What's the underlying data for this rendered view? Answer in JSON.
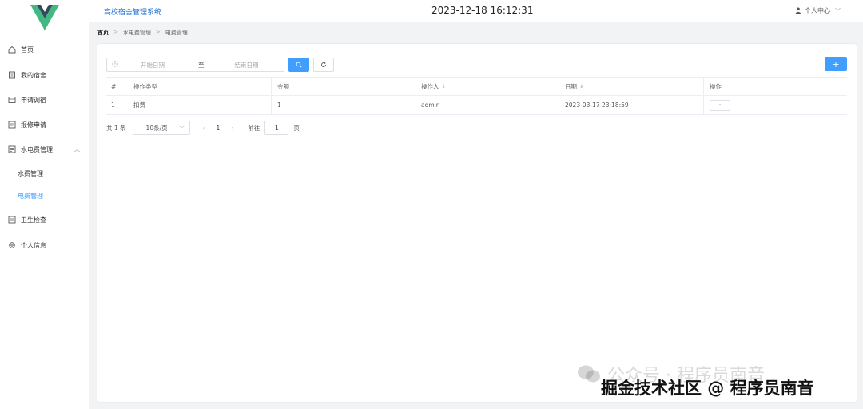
{
  "header": {
    "app_title": "高校宿舍管理系统",
    "clock": "2023-12-18 16:12:31",
    "user_label": "个人中心"
  },
  "sidebar": {
    "items": [
      {
        "label": "首页",
        "icon": "home-icon"
      },
      {
        "label": "我的宿舍",
        "icon": "building-icon"
      },
      {
        "label": "申请调宿",
        "icon": "swap-icon"
      },
      {
        "label": "报修申请",
        "icon": "repair-icon"
      },
      {
        "label": "水电费管理",
        "icon": "bill-icon",
        "expanded": true
      },
      {
        "label": "卫生检查",
        "icon": "checklist-icon"
      },
      {
        "label": "个人信息",
        "icon": "gear-icon"
      }
    ],
    "submenu": [
      {
        "label": "水费管理",
        "active": false
      },
      {
        "label": "电费管理",
        "active": true
      }
    ]
  },
  "breadcrumb": [
    "首页",
    "水电费管理",
    "电费管理"
  ],
  "filters": {
    "start_placeholder": "开始日期",
    "separator": "至",
    "end_placeholder": "结束日期"
  },
  "table": {
    "columns": [
      "#",
      "操作类型",
      "金额",
      "操作人",
      "日期",
      "操作"
    ],
    "rows": [
      {
        "index": "1",
        "type": "扣费",
        "amount": "1",
        "operator": "admin",
        "date": "2023-03-17 23:18:59",
        "action": "···"
      }
    ]
  },
  "pagination": {
    "total": "共 1 条",
    "page_size": "10条/页",
    "current": "1",
    "goto_label": "前往",
    "goto_value": "1",
    "unit": "页"
  },
  "watermark": {
    "back": "公众号 · 程序员南音",
    "front": "掘金技术社区 @ 程序员南音"
  },
  "colors": {
    "accent": "#409eff",
    "title": "#1f6fd1"
  }
}
